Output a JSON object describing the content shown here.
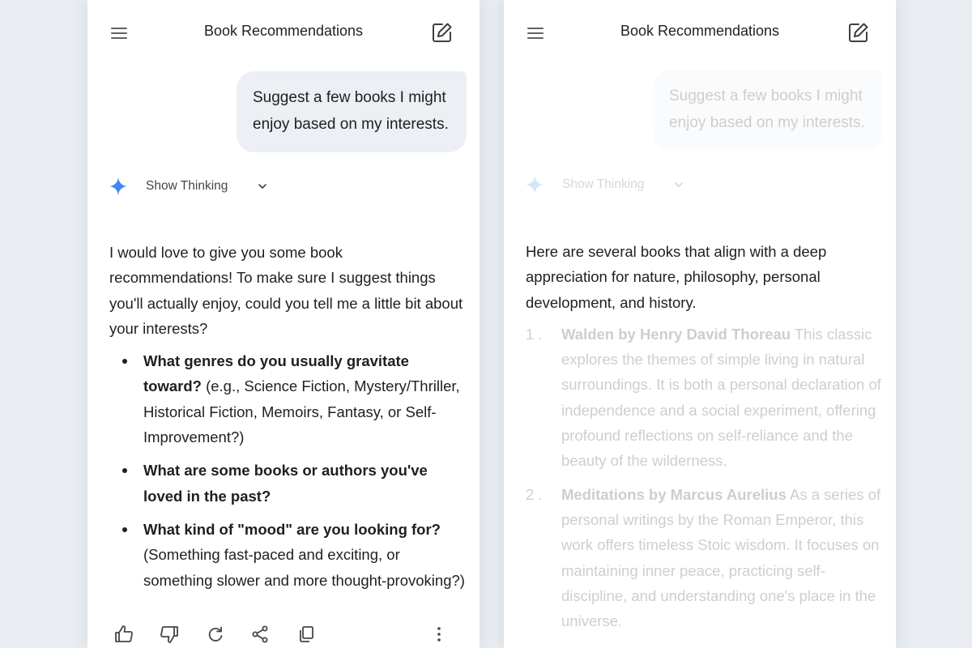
{
  "panels": [
    {
      "title": "Book Recommendations",
      "user_message": "Suggest a few books I might enjoy based on my interests.",
      "show_thinking_label": "Show Thinking",
      "response_intro": "I would love to give you some book recommendations! To make sure I suggest things you'll actually enjoy, could you tell me a little bit about your interests?",
      "questions": [
        {
          "bold": "What genres do you usually gravitate toward?",
          "rest": " (e.g., Science Fiction, Mystery/Thriller, Historical Fiction, Memoirs, Fantasy, or Self-Improvement?)"
        },
        {
          "bold": "What are some books or authors you've loved in the past?",
          "rest": ""
        },
        {
          "bold": "What kind of \"mood\" are you looking for?",
          "rest": " (Something fast-paced and exciting, or something slower and more thought-provoking?)"
        }
      ],
      "action_icons": [
        "thumbs-up-icon",
        "thumbs-down-icon",
        "regenerate-icon",
        "share-icon",
        "copy-icon",
        "more-vert-icon"
      ]
    },
    {
      "title": "Book Recommendations",
      "user_message": "Suggest a few books I might enjoy based on my interests.",
      "show_thinking_label": "Show Thinking",
      "response_intro": "Here are several books that align with a deep appreciation for nature, philosophy, personal development, and history.",
      "books": [
        {
          "num": "1 .",
          "title": "Walden by Henry David Thoreau",
          "desc": " This classic explores the themes of simple living in natural surroundings. It is both a personal declaration of independence and a social experiment, offering profound reflections on self-reliance and the beauty of the wilderness."
        },
        {
          "num": "2 .",
          "title": "Meditations by Marcus Aurelius",
          "desc": " As a series of personal writings by the Roman Emperor, this work offers timeless Stoic wisdom. It focuses on maintaining inner peace, practicing self-discipline, and understanding one's place in the universe."
        }
      ]
    }
  ],
  "colors": {
    "background": "#e9edf2",
    "panel": "#ffffff",
    "user_bubble": "#eceff4",
    "text": "#1f1f1f",
    "sparkle_blue": "#4285f4"
  }
}
